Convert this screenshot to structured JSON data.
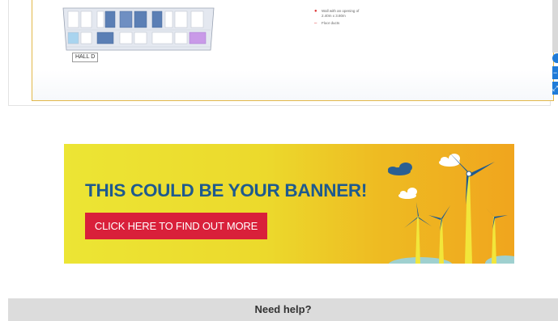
{
  "floorplan": {
    "hall_label": "HALL D",
    "legend": [
      {
        "marker": "red-dot",
        "lines": [
          "Wall with an opening of",
          "2.40m x 3.80m"
        ]
      },
      {
        "marker": "red-dash",
        "lines": [
          "Floor ducts"
        ]
      }
    ]
  },
  "map_controls": {
    "zoom_out_label": "−",
    "fullscreen_label": "⤢"
  },
  "banner": {
    "headline": "THIS COULD BE YOUR BANNER!",
    "cta_label": "CLICK HERE TO FIND OUT MORE",
    "colors": {
      "headline": "#1e5a8e",
      "cta_bg": "#d9203a",
      "bg_start": "#ece534",
      "bg_end": "#f0a51e"
    },
    "art_icon": "wind-turbines-illustration"
  },
  "help_bar": {
    "label": "Need help?"
  }
}
